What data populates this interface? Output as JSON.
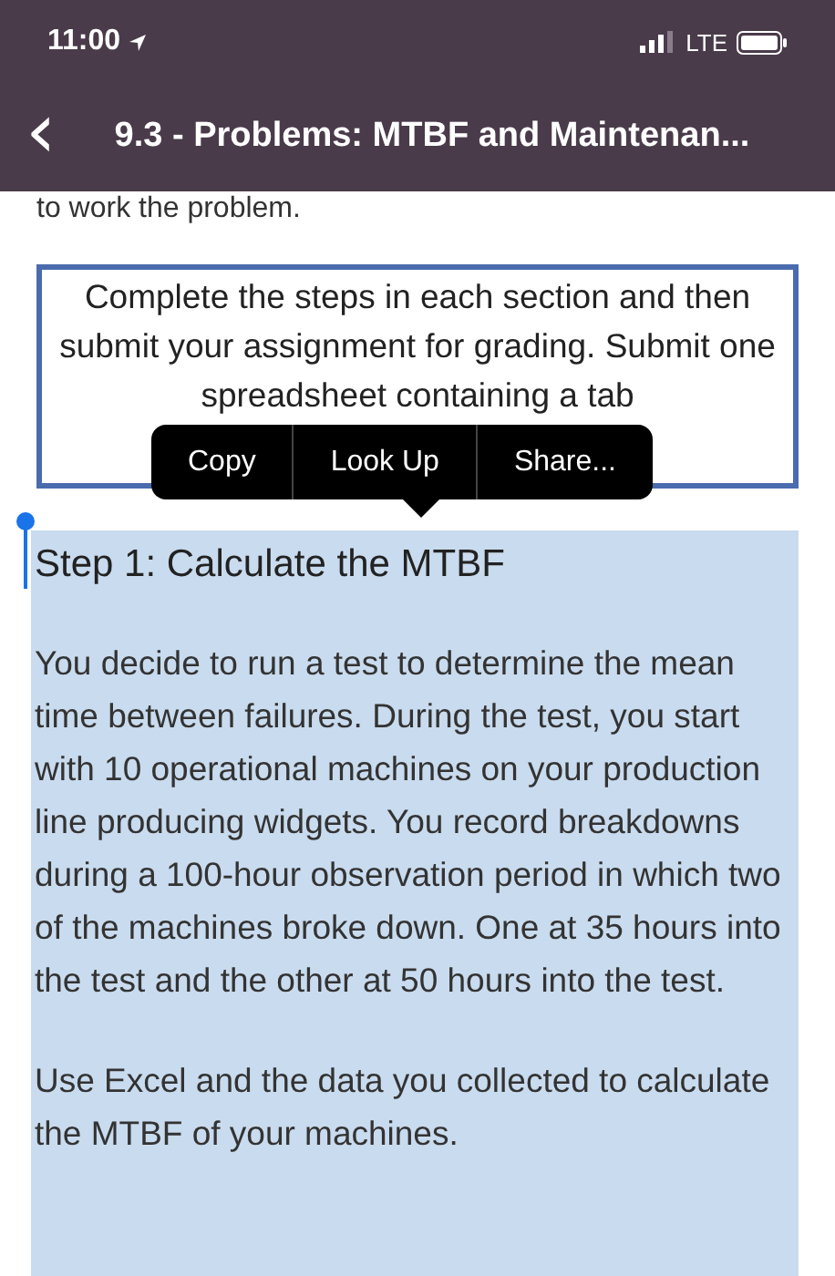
{
  "status_bar": {
    "time": "11:00",
    "network": "LTE"
  },
  "nav_bar": {
    "back_icon": "‹",
    "title": "9.3 - Problems: MTBF and Maintenan..."
  },
  "cut_line": "to work the problem.",
  "callout": {
    "text": "Complete the steps in each section and then submit your assignment for grading. Submit one spreadsheet containing a tab"
  },
  "context_menu": {
    "items": [
      {
        "label": "Copy"
      },
      {
        "label": "Look Up"
      },
      {
        "label": "Share..."
      }
    ]
  },
  "selection": {
    "heading": "Step 1: Calculate the MTBF",
    "paragraphs": [
      "You decide to run a test to determine the mean time between failures. During the test, you start with 10 operational machines on your production line producing widgets. You record breakdowns during a 100-hour observation period in which two of the machines broke down. One at 35 hours into the test and the other at 50 hours into the test.",
      "Use Excel and the data you collected to calculate the MTBF of your machines."
    ]
  }
}
